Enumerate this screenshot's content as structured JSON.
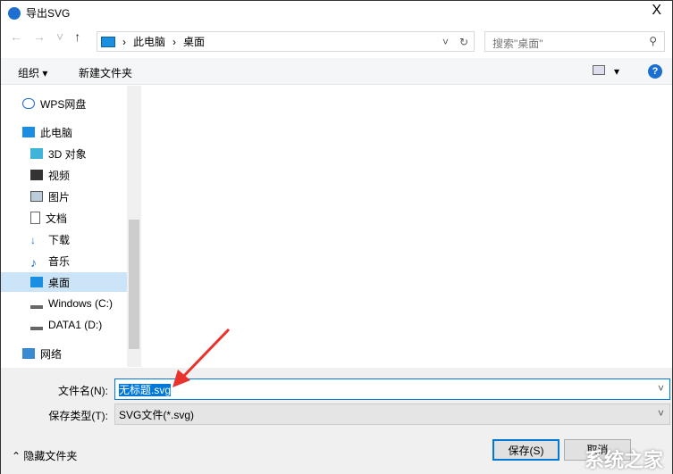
{
  "window": {
    "title": "导出SVG",
    "close": "X"
  },
  "nav": {
    "back": "←",
    "forward": "→",
    "recent": "˅",
    "up": "↑"
  },
  "address": {
    "crumbs": [
      "此电脑",
      "桌面"
    ],
    "sep": "›",
    "dropdown": "˅",
    "refresh": "↻"
  },
  "search": {
    "placeholder": "搜索\"桌面\"",
    "icon": "⚲"
  },
  "toolbar": {
    "organize": "组织 ▾",
    "new_folder": "新建文件夹",
    "view": "▾",
    "help": "?"
  },
  "sidebar": {
    "items": [
      {
        "label": "WPS网盘",
        "icon": "cloud-icon"
      },
      {
        "label": "此电脑",
        "icon": "computer-icon"
      },
      {
        "label": "3D 对象",
        "icon": "cube-icon"
      },
      {
        "label": "视频",
        "icon": "video-icon"
      },
      {
        "label": "图片",
        "icon": "picture-icon"
      },
      {
        "label": "文档",
        "icon": "document-icon"
      },
      {
        "label": "下载",
        "icon": "download-icon"
      },
      {
        "label": "音乐",
        "icon": "music-icon"
      },
      {
        "label": "桌面",
        "icon": "desktop-icon",
        "selected": true
      },
      {
        "label": "Windows (C:)",
        "icon": "drive-icon"
      },
      {
        "label": "DATA1 (D:)",
        "icon": "drive-icon"
      },
      {
        "label": "网络",
        "icon": "network-icon"
      }
    ]
  },
  "form": {
    "filename_label": "文件名(N):",
    "filename": "无标题.svg",
    "type_label": "保存类型(T):",
    "type": "SVG文件(*.svg)",
    "chev": "˅"
  },
  "footer": {
    "hide_folders": "隐藏文件夹",
    "save": "保存(S)",
    "cancel": "取消"
  },
  "watermark": "系统之家"
}
